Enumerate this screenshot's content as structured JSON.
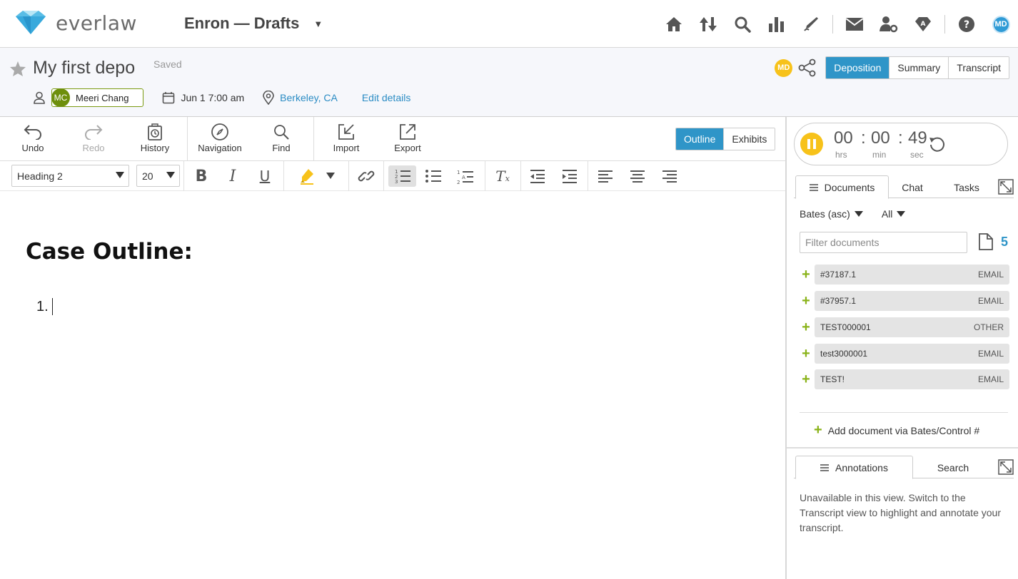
{
  "app": {
    "brand": "everlaw",
    "project": "Enron — Drafts",
    "accent": "#2f95c8",
    "brand_green": "#8ab31a"
  },
  "nav": {
    "icons": [
      "home-icon",
      "transfer-icon",
      "search-icon",
      "analytics-icon",
      "pen-icon",
      "mail-icon",
      "admin-icon",
      "gem-icon",
      "help-icon"
    ],
    "user_initials": "MD"
  },
  "header": {
    "title": "My first depo",
    "status": "Saved",
    "witness_initials": "MC",
    "witness_name": "Meeri Chang",
    "datetime": "Jun 1 7:00 am",
    "location": "Berkeley, CA",
    "edit_details": "Edit details",
    "collaborator_initials": "MD",
    "view_tabs": [
      "Deposition",
      "Summary",
      "Transcript"
    ],
    "active_view": "Deposition"
  },
  "toolbar": {
    "undo": "Undo",
    "redo": "Redo",
    "history": "History",
    "navigation": "Navigation",
    "find": "Find",
    "import": "Import",
    "export": "Export",
    "outline": "Outline",
    "exhibits": "Exhibits",
    "style_select": "Heading 2",
    "size_select": "20"
  },
  "editor": {
    "heading": "Case Outline:",
    "list_marker": "1."
  },
  "timer": {
    "hours": "00",
    "minutes": "00",
    "seconds": "49",
    "hrs_label": "hrs",
    "min_label": "min",
    "sec_label": "sec"
  },
  "panel": {
    "tabs": [
      "Documents",
      "Chat",
      "Tasks"
    ],
    "sort": "Bates (asc)",
    "filter_type": "All",
    "filter_placeholder": "Filter documents",
    "doc_count": "5",
    "documents": [
      {
        "id": "#37187.1",
        "type": "EMAIL"
      },
      {
        "id": "#37957.1",
        "type": "EMAIL"
      },
      {
        "id": "TEST000001",
        "type": "OTHER"
      },
      {
        "id": "test3000001",
        "type": "EMAIL"
      },
      {
        "id": "TEST!",
        "type": "EMAIL"
      }
    ],
    "add_document": "Add document via Bates/Control #",
    "bottom_tabs": [
      "Annotations",
      "Search"
    ],
    "unavailable_text": "Unavailable in this view. Switch to the Transcript view to highlight and annotate your transcript."
  }
}
